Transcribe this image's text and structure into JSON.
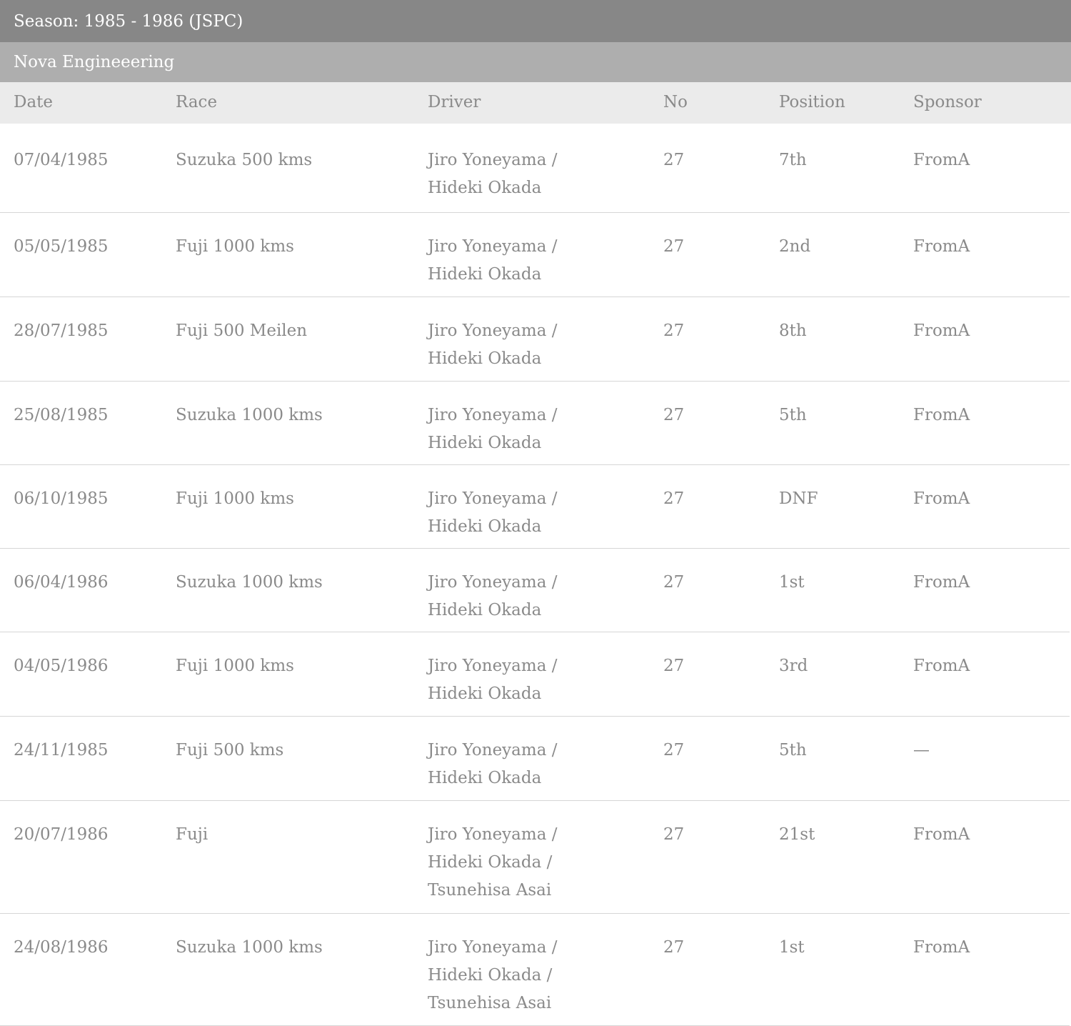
{
  "season_title": "Season: 1985 - 1986 (JSPC)",
  "team_name": "Nova Engineeering",
  "columns": {
    "date": "Date",
    "race": "Race",
    "driver": "Driver",
    "no": "No",
    "position": "Position",
    "sponsor": "Sponsor"
  },
  "rows": [
    {
      "date": "07/04/1985",
      "race": "Suzuka 500 kms",
      "driver_lines": [
        "Jiro Yoneyama /",
        "Hideki Okada"
      ],
      "no": "27",
      "position": "7th",
      "sponsor": "FromA"
    },
    {
      "date": "05/05/1985",
      "race": "Fuji 1000 kms",
      "driver_lines": [
        "Jiro Yoneyama /",
        "Hideki Okada"
      ],
      "no": "27",
      "position": "2nd",
      "sponsor": "FromA"
    },
    {
      "date": "28/07/1985",
      "race": "Fuji 500 Meilen",
      "driver_lines": [
        "Jiro Yoneyama /",
        "Hideki Okada"
      ],
      "no": "27",
      "position": "8th",
      "sponsor": "FromA"
    },
    {
      "date": "25/08/1985",
      "race": "Suzuka 1000 kms",
      "driver_lines": [
        "Jiro Yoneyama /",
        "Hideki Okada"
      ],
      "no": "27",
      "position": "5th",
      "sponsor": "FromA"
    },
    {
      "date": "06/10/1985",
      "race": "Fuji 1000 kms",
      "driver_lines": [
        "Jiro Yoneyama /",
        "Hideki Okada"
      ],
      "no": "27",
      "position": "DNF",
      "sponsor": "FromA"
    },
    {
      "date": "06/04/1986",
      "race": "Suzuka 1000 kms",
      "driver_lines": [
        "Jiro Yoneyama /",
        "Hideki Okada"
      ],
      "no": "27",
      "position": "1st",
      "sponsor": "FromA"
    },
    {
      "date": "04/05/1986",
      "race": "Fuji 1000 kms",
      "driver_lines": [
        "Jiro Yoneyama /",
        "Hideki Okada"
      ],
      "no": "27",
      "position": "3rd",
      "sponsor": "FromA"
    },
    {
      "date": "24/11/1985",
      "race": "Fuji 500 kms",
      "driver_lines": [
        "Jiro Yoneyama /",
        "Hideki Okada"
      ],
      "no": "27",
      "position": "5th",
      "sponsor": "—"
    },
    {
      "date": "20/07/1986",
      "race": "Fuji",
      "driver_lines": [
        "Jiro Yoneyama /",
        "Hideki Okada /",
        "Tsunehisa Asai"
      ],
      "no": "27",
      "position": "21st",
      "sponsor": "FromA"
    },
    {
      "date": "24/08/1986",
      "race": "Suzuka 1000 kms",
      "driver_lines": [
        "Jiro Yoneyama /",
        "Hideki Okada /",
        "Tsunehisa Asai"
      ],
      "no": "27",
      "position": "1st",
      "sponsor": "FromA"
    }
  ]
}
